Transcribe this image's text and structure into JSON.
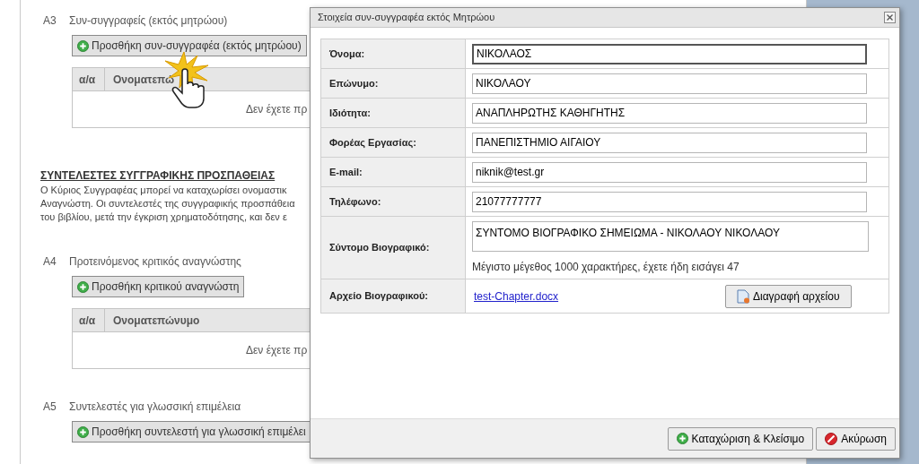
{
  "page": {
    "blocks": [
      {
        "kind": "section",
        "code": "A3",
        "title": "Συν-συγγραφείς (εκτός μητρώου)",
        "add_button": "Προσθήκη συν-συγγραφέα (εκτός μητρώου)",
        "table": {
          "columns": [
            "α/α",
            "Ονοματεπώ"
          ],
          "empty_text": "Δεν έχετε πρ"
        }
      },
      {
        "kind": "note",
        "heading": "ΣΥΝΤΕΛΕΣΤΕΣ ΣΥΓΓΡΑΦΙΚΗΣ ΠΡΟΣΠΑΘΕΙΑΣ",
        "lines": [
          "Ο Κύριος Συγγραφέας μπορεί να καταχωρίσει ονομαστικ",
          "Αναγνώστη. Οι συντελεστές της συγγραφικής προσπάθεια",
          "του βιβλίου, μετά την έγκριση χρηματοδότησης, και δεν ε"
        ]
      },
      {
        "kind": "section",
        "code": "A4",
        "title": "Προτεινόμενος κριτικός αναγνώστης",
        "add_button": "Προσθήκη κριτικού αναγνώστη",
        "table": {
          "columns": [
            "α/α",
            "Ονοματεπώνυμο"
          ],
          "empty_text": "Δεν έχετε πρ"
        }
      },
      {
        "kind": "section",
        "code": "A5",
        "title": "Συντελεστές για γλωσσική επιμέλεια",
        "add_button": "Προσθήκη συντελεστή για γλωσσική επιμέλει"
      }
    ]
  },
  "dialog": {
    "title": "Στοιχεία συν-συγγραφέα εκτός Μητρώου",
    "fields": [
      {
        "kind": "input",
        "label": "Όνομα:",
        "value": "ΝΙΚΟΛΑΟΣ",
        "focused": true
      },
      {
        "kind": "input",
        "label": "Επώνυμο:",
        "value": "ΝΙΚΟΛΑΟΥ",
        "focused": false
      },
      {
        "kind": "input",
        "label": "Ιδιότητα:",
        "value": "ΑΝΑΠΛΗΡΩΤΗΣ ΚΑΘΗΓΗΤΗΣ",
        "focused": false
      },
      {
        "kind": "input",
        "label": "Φορέας Εργασίας:",
        "value": "ΠΑΝΕΠΙΣΤΗΜΙΟ ΑΙΓΑΙΟΥ",
        "focused": false
      },
      {
        "kind": "input",
        "label": "E-mail:",
        "value": "niknik@test.gr",
        "focused": false
      },
      {
        "kind": "input",
        "label": "Τηλέφωνο:",
        "value": "21077777777",
        "focused": false
      },
      {
        "kind": "textarea",
        "label": "Σύντομο Βιογραφικό:",
        "value": "ΣΥΝΤΟΜΟ ΒΙΟΓΡΑΦΙΚΟ ΣΗΜΕΙΩΜΑ - ΝΙΚΟΛΑΟΥ ΝΙΚΟΛΑΟΥ",
        "hint": "Μέγιστο μέγεθος 1000 χαρακτήρες, έχετε ήδη εισάγει 47"
      },
      {
        "kind": "file",
        "label": "Αρχείο Βιογραφικού:",
        "file_link": "test-Chapter.docx",
        "delete_button": "Διαγραφή αρχείου"
      }
    ],
    "buttons": [
      {
        "kind": "save",
        "label": "Καταχώριση & Κλείσιμο"
      },
      {
        "kind": "cancel",
        "label": "Ακύρωση"
      }
    ]
  }
}
